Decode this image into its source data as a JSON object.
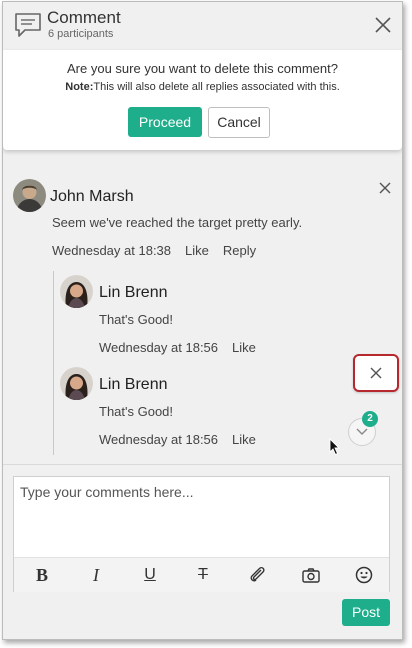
{
  "header": {
    "title": "Comment",
    "participants": "6 participants"
  },
  "confirm_dialog": {
    "question": "Are you sure you want to delete this comment?",
    "note_label": "Note:",
    "note_text": "This will also delete all replies associated with this.",
    "proceed_label": "Proceed",
    "cancel_label": "Cancel"
  },
  "thread": {
    "comment": {
      "author": "John Marsh",
      "text": "Seem we've reached the target pretty early.",
      "time": "Wednesday at 18:38",
      "like_label": "Like",
      "reply_label": "Reply"
    },
    "replies": [
      {
        "author": "Lin Brenn",
        "text": "That's Good!",
        "time": "Wednesday at 18:56",
        "like_label": "Like"
      },
      {
        "author": "Lin Brenn",
        "text": "That's Good!",
        "time": "Wednesday at 18:56",
        "like_label": "Like"
      }
    ],
    "new_count": "2"
  },
  "composer": {
    "placeholder": "Type your comments here...",
    "tools": [
      "bold-icon",
      "italic-icon",
      "underline-icon",
      "strikethrough-icon",
      "attachment-icon",
      "camera-icon",
      "emoji-icon"
    ],
    "post_label": "Post"
  },
  "colors": {
    "accent": "#1fae8b",
    "highlight": "#b7282e",
    "panel_bg": "#f0f0f0"
  }
}
